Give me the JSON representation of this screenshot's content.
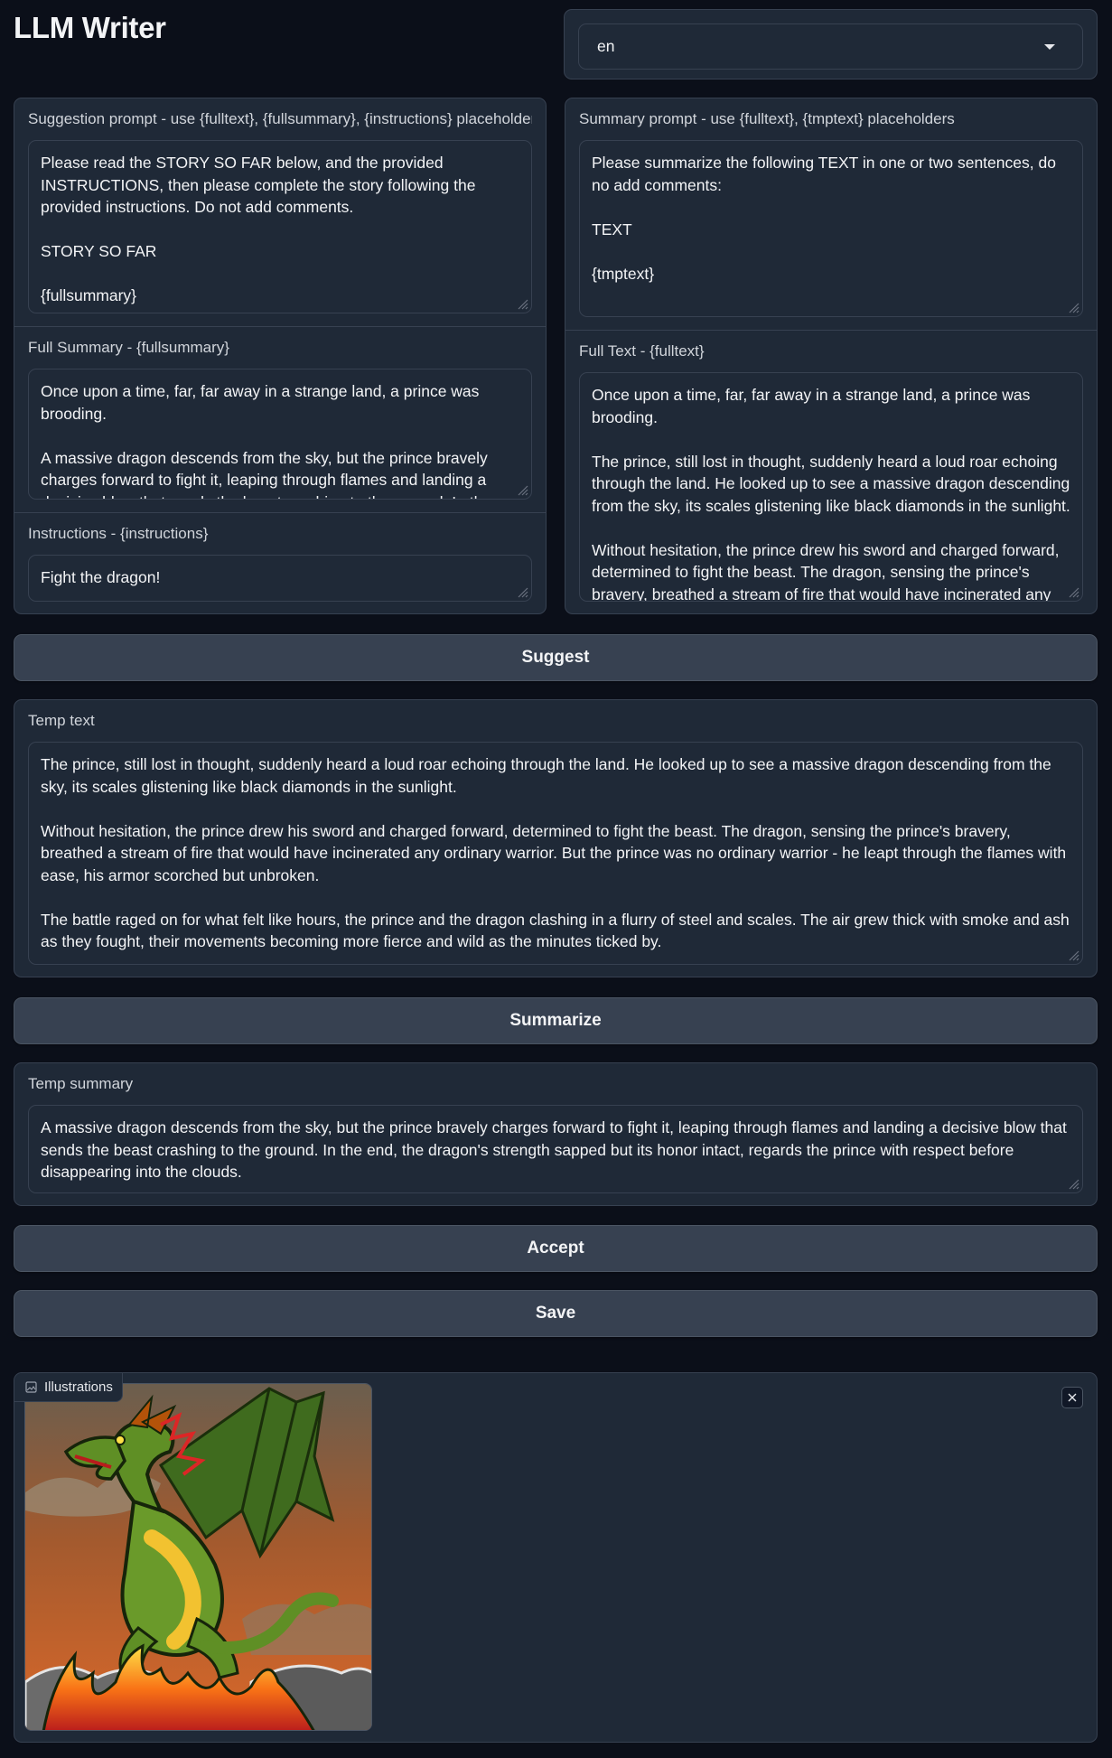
{
  "app": {
    "title": "LLM Writer"
  },
  "language": {
    "selected": "en"
  },
  "suggestion_prompt": {
    "label": "Suggestion prompt - use {fulltext}, {fullsummary}, {instructions} placeholders",
    "value": "Please read the STORY SO FAR below, and the provided INSTRUCTIONS, then please complete the story following the provided instructions. Do not add comments.\n\nSTORY SO FAR\n\n{fullsummary}"
  },
  "full_summary": {
    "label": "Full Summary - {fullsummary}",
    "value": "Once upon a time, far, far away in a strange land, a prince was brooding.\n\nA massive dragon descends from the sky, but the prince bravely charges forward to fight it, leaping through flames and landing a decisive blow that sends the beast crashing to the ground. In the end, the dragon's strength sapped but its honor intact, regards the prince with respect"
  },
  "instructions": {
    "label": "Instructions - {instructions}",
    "value": "Fight the dragon!"
  },
  "summary_prompt": {
    "label": "Summary prompt - use {fulltext}, {tmptext} placeholders",
    "value": "Please summarize the following TEXT in one or two sentences, do no add comments:\n\nTEXT\n\n{tmptext}"
  },
  "full_text": {
    "label": "Full Text - {fulltext}",
    "value": "Once upon a time, far, far away in a strange land, a prince was brooding.\n\nThe prince, still lost in thought, suddenly heard a loud roar echoing through the land. He looked up to see a massive dragon descending from the sky, its scales glistening like black diamonds in the sunlight.\n\nWithout hesitation, the prince drew his sword and charged forward, determined to fight the beast. The dragon, sensing the prince's bravery, breathed a stream of fire that would have incinerated any ordinary warrior. But the prince was no ordinary warrior - he leapt through the flames with ease, his armor scorched but unbroken."
  },
  "buttons": {
    "suggest": "Suggest",
    "summarize": "Summarize",
    "accept": "Accept",
    "save": "Save"
  },
  "temp_text": {
    "label": "Temp text",
    "value": "The prince, still lost in thought, suddenly heard a loud roar echoing through the land. He looked up to see a massive dragon descending from the sky, its scales glistening like black diamonds in the sunlight.\n\nWithout hesitation, the prince drew his sword and charged forward, determined to fight the beast. The dragon, sensing the prince's bravery, breathed a stream of fire that would have incinerated any ordinary warrior. But the prince was no ordinary warrior - he leapt through the flames with ease, his armor scorched but unbroken.\n\nThe battle raged on for what felt like hours, the prince and the dragon clashing in a flurry of steel and scales. The air grew thick with smoke and ash as they fought, their movements becoming more fierce and wild as the minutes ticked by."
  },
  "temp_summary": {
    "label": "Temp summary",
    "value": "A massive dragon descends from the sky, but the prince bravely charges forward to fight it, leaping through flames and landing a decisive blow that sends the beast crashing to the ground. In the end, the dragon's strength sapped but its honor intact, regards the prince with respect before disappearing into the clouds."
  },
  "gallery": {
    "label": "Illustrations",
    "icons": [
      "image-icon",
      "close-icon",
      "resize-grip-icon",
      "chevron-down-icon"
    ]
  },
  "colors": {
    "background": "#0b0f19",
    "panel": "#1f2937",
    "border": "#374151",
    "button": "#374151"
  }
}
